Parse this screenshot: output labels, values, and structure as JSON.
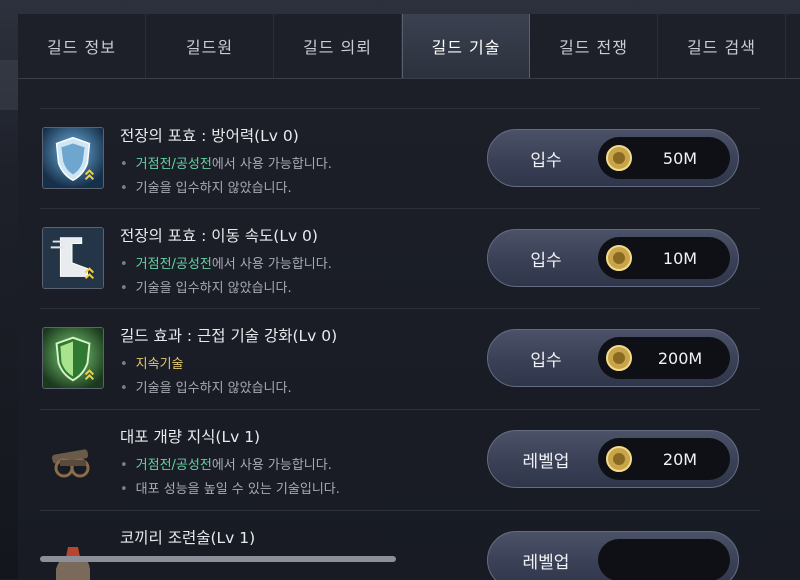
{
  "tabs": [
    {
      "label": "길드 정보",
      "active": false
    },
    {
      "label": "길드원",
      "active": false
    },
    {
      "label": "길드 의뢰",
      "active": false
    },
    {
      "label": "길드 기술",
      "active": true
    },
    {
      "label": "길드 전쟁",
      "active": false
    },
    {
      "label": "길드 검색",
      "active": false
    }
  ],
  "skills": [
    {
      "title": "전장의 포효 : 방어력(Lv 0)",
      "icon": "blue-shield-icon",
      "line1_highlight": "거점전/공성전",
      "line1_rest": "에서 사용 가능합니다.",
      "line2": "기술을 입수하지 않았습니다.",
      "button": "입수",
      "price": "50M"
    },
    {
      "title": "전장의 포효 : 이동 속도(Lv 0)",
      "icon": "boot-icon",
      "line1_highlight": "거점전/공성전",
      "line1_rest": "에서 사용 가능합니다.",
      "line2": "기술을 입수하지 않았습니다.",
      "button": "입수",
      "price": "10M"
    },
    {
      "title": "길드 효과 : 근접 기술 강화(Lv 0)",
      "icon": "green-shield-icon",
      "line1_highlight": "지속기술",
      "line1_rest": "",
      "line2": "기술을 입수하지 않았습니다.",
      "button": "입수",
      "price": "200M"
    },
    {
      "title": "대포 개량 지식(Lv 1)",
      "icon": "cannon-icon",
      "line1_highlight": "거점전/공성전",
      "line1_rest": "에서 사용 가능합니다.",
      "line2": "대포 성능을 높일 수 있는 기술입니다.",
      "button": "레벨업",
      "price": "20M"
    },
    {
      "title": "코끼리 조련술(Lv 1)",
      "icon": "elephant-icon",
      "button": "레벨업"
    }
  ],
  "colors": {
    "highlight_green": "#63d3a2",
    "highlight_yellow": "#e4c86b"
  }
}
